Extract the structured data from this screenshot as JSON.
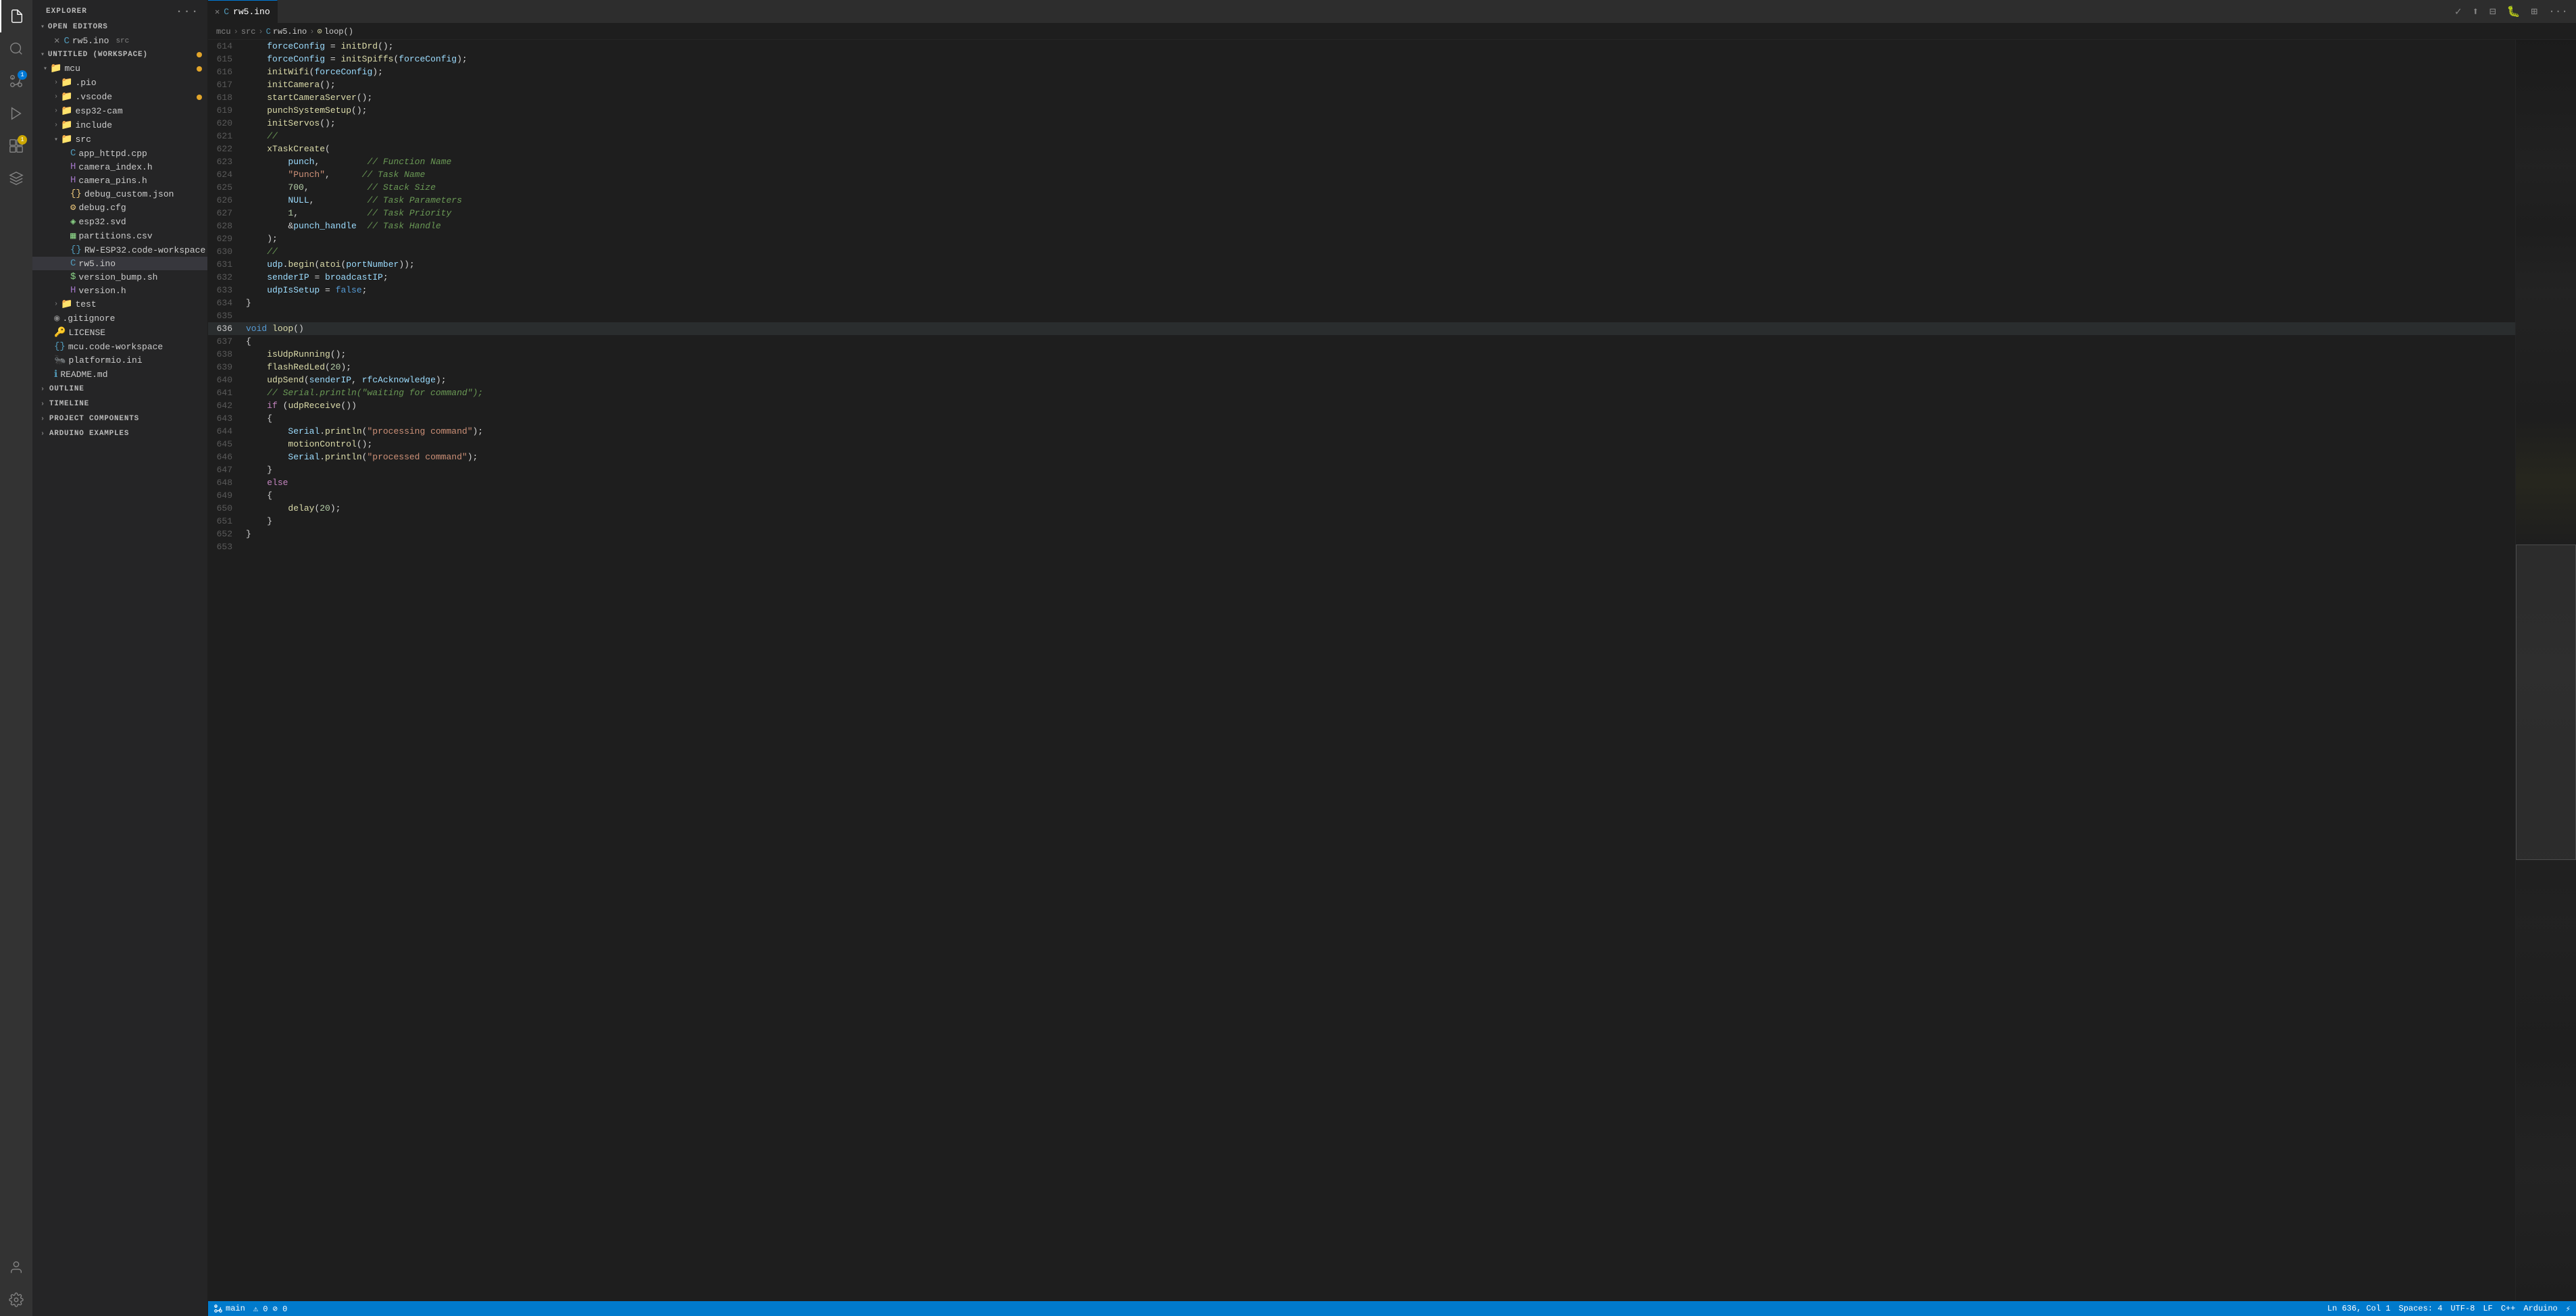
{
  "activityBar": {
    "icons": [
      {
        "name": "files-icon",
        "symbol": "⎘",
        "active": true,
        "badge": null
      },
      {
        "name": "search-icon",
        "symbol": "🔍",
        "active": false,
        "badge": null
      },
      {
        "name": "source-control-icon",
        "symbol": "⎇",
        "active": false,
        "badge": "1",
        "badgeColor": "blue"
      },
      {
        "name": "run-icon",
        "symbol": "▷",
        "active": false,
        "badge": null
      },
      {
        "name": "extensions-icon",
        "symbol": "⊞",
        "active": false,
        "badge": "1",
        "badgeColor": "yellow"
      },
      {
        "name": "platformio-icon",
        "symbol": "🐜",
        "active": false,
        "badge": null
      },
      {
        "name": "python-icon",
        "symbol": "🐍",
        "active": false,
        "badge": null
      }
    ],
    "bottomIcons": [
      {
        "name": "accounts-icon",
        "symbol": "👤"
      },
      {
        "name": "settings-icon",
        "symbol": "⚙"
      }
    ]
  },
  "sidebar": {
    "title": "EXPLORER",
    "sections": {
      "openEditors": {
        "label": "OPEN EDITORS",
        "items": [
          {
            "name": "rw5.ino",
            "icon": "ino",
            "path": "src",
            "active": true,
            "hasClose": true
          }
        ]
      },
      "workspace": {
        "label": "UNTITLED (WORKSPACE)",
        "hasDot": true,
        "tree": [
          {
            "type": "folder",
            "name": "mcu",
            "indent": 0,
            "open": true,
            "hasDot": true
          },
          {
            "type": "folder",
            "name": ".pio",
            "indent": 1,
            "open": false
          },
          {
            "type": "folder",
            "name": ".vscode",
            "indent": 1,
            "open": false,
            "hasDot": true
          },
          {
            "type": "folder",
            "name": "esp32-cam",
            "indent": 1,
            "open": false
          },
          {
            "type": "folder",
            "name": "include",
            "indent": 1,
            "open": false
          },
          {
            "type": "folder",
            "name": "src",
            "indent": 1,
            "open": true
          },
          {
            "type": "file",
            "name": "app_httpd.cpp",
            "icon": "cpp",
            "indent": 2
          },
          {
            "type": "file",
            "name": "camera_index.h",
            "icon": "h",
            "indent": 2
          },
          {
            "type": "file",
            "name": "camera_pins.h",
            "icon": "h",
            "indent": 2
          },
          {
            "type": "file",
            "name": "debug_custom.json",
            "icon": "json",
            "indent": 2
          },
          {
            "type": "file",
            "name": "debug.cfg",
            "icon": "cfg",
            "indent": 2
          },
          {
            "type": "file",
            "name": "esp32.svd",
            "icon": "svd",
            "indent": 2
          },
          {
            "type": "file",
            "name": "partitions.csv",
            "icon": "csv",
            "indent": 2
          },
          {
            "type": "file",
            "name": "RW-ESP32.code-workspace",
            "icon": "workspace",
            "indent": 2
          },
          {
            "type": "file",
            "name": "rw5.ino",
            "icon": "ino",
            "indent": 2,
            "active": true
          },
          {
            "type": "file",
            "name": "version_bump.sh",
            "icon": "sh",
            "indent": 2
          },
          {
            "type": "file",
            "name": "version.h",
            "icon": "h",
            "indent": 2
          },
          {
            "type": "folder",
            "name": "test",
            "indent": 1,
            "open": false
          },
          {
            "type": "file",
            "name": ".gitignore",
            "icon": "gitignore",
            "indent": 1
          },
          {
            "type": "file",
            "name": "LICENSE",
            "icon": "license",
            "indent": 1
          },
          {
            "type": "file",
            "name": "mcu.code-workspace",
            "icon": "workspace",
            "indent": 1
          },
          {
            "type": "file",
            "name": "platformio.ini",
            "icon": "ini",
            "indent": 1
          },
          {
            "type": "file",
            "name": "README.md",
            "icon": "md",
            "indent": 1
          }
        ]
      }
    },
    "bottomSections": [
      {
        "label": "OUTLINE",
        "open": false
      },
      {
        "label": "TIMELINE",
        "open": false
      },
      {
        "label": "PROJECT COMPONENTS",
        "open": false
      },
      {
        "label": "ARDUINO EXAMPLES",
        "open": false
      }
    ]
  },
  "tabs": [
    {
      "name": "rw5.ino",
      "icon": "ino",
      "active": true,
      "hasClose": true
    }
  ],
  "breadcrumb": {
    "parts": [
      "mcu",
      "src",
      "rw5.ino",
      "loop()"
    ]
  },
  "code": {
    "lines": [
      {
        "num": 614,
        "content": "    forceConfig = initDrd();"
      },
      {
        "num": 615,
        "content": "    forceConfig = initSpiffs(forceConfig);"
      },
      {
        "num": 616,
        "content": "    initWifi(forceConfig);"
      },
      {
        "num": 617,
        "content": "    initCamera();"
      },
      {
        "num": 618,
        "content": "    startCameraServer();"
      },
      {
        "num": 619,
        "content": "    punchSystemSetup();"
      },
      {
        "num": 620,
        "content": "    initServos();"
      },
      {
        "num": 621,
        "content": "    //"
      },
      {
        "num": 622,
        "content": "    xTaskCreate("
      },
      {
        "num": 623,
        "content": "        punch,         // Function Name"
      },
      {
        "num": 624,
        "content": "        \"Punch\",      // Task Name"
      },
      {
        "num": 625,
        "content": "        700,           // Stack Size"
      },
      {
        "num": 626,
        "content": "        NULL,          // Task Parameters"
      },
      {
        "num": 627,
        "content": "        1,             // Task Priority"
      },
      {
        "num": 628,
        "content": "        &punch_handle  // Task Handle"
      },
      {
        "num": 629,
        "content": "    );"
      },
      {
        "num": 630,
        "content": "    //"
      },
      {
        "num": 631,
        "content": "    udp.begin(atoi(portNumber));"
      },
      {
        "num": 632,
        "content": "    senderIP = broadcastIP;"
      },
      {
        "num": 633,
        "content": "    udpIsSetup = false;"
      },
      {
        "num": 634,
        "content": "}"
      },
      {
        "num": 635,
        "content": ""
      },
      {
        "num": 636,
        "content": "void loop()"
      },
      {
        "num": 637,
        "content": "{"
      },
      {
        "num": 638,
        "content": "    isUdpRunning();"
      },
      {
        "num": 639,
        "content": "    flashRedLed(20);"
      },
      {
        "num": 640,
        "content": "    udpSend(senderIP, rfcAcknowledge);"
      },
      {
        "num": 641,
        "content": "    // Serial.println(\"waiting for command\");"
      },
      {
        "num": 642,
        "content": "    if (udpReceive())"
      },
      {
        "num": 643,
        "content": "    {"
      },
      {
        "num": 644,
        "content": "        Serial.println(\"processing command\");"
      },
      {
        "num": 645,
        "content": "        motionControl();"
      },
      {
        "num": 646,
        "content": "        Serial.println(\"processed command\");"
      },
      {
        "num": 647,
        "content": "    }"
      },
      {
        "num": 648,
        "content": "    else"
      },
      {
        "num": 649,
        "content": "    {"
      },
      {
        "num": 650,
        "content": "        delay(20);"
      },
      {
        "num": 651,
        "content": "    }"
      },
      {
        "num": 652,
        "content": "}"
      },
      {
        "num": 653,
        "content": ""
      }
    ]
  },
  "statusBar": {
    "left": [
      "⎔",
      "main"
    ],
    "right": [
      "Ln 636, Col 1",
      "Spaces: 4",
      "UTF-8",
      "LF",
      "C++",
      "Arduino",
      "⚡"
    ]
  }
}
